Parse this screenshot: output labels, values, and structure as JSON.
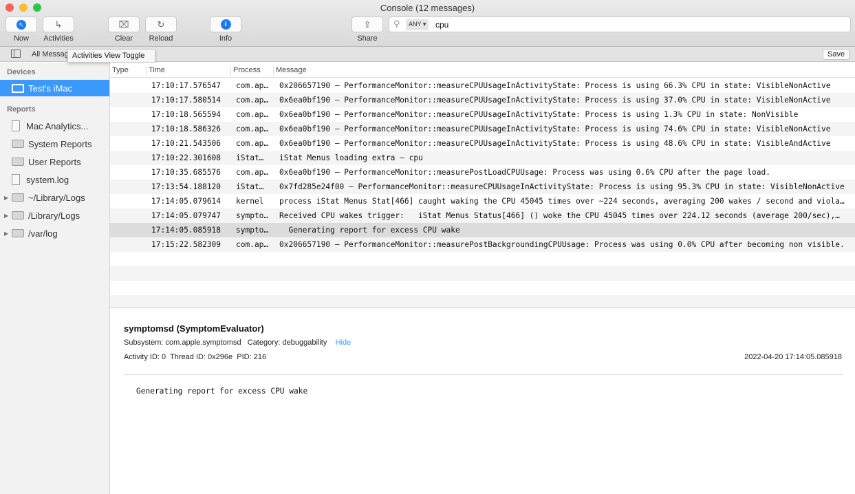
{
  "window": {
    "title": "Console (12 messages)"
  },
  "toolbar": {
    "now": "Now",
    "activities": "Activities",
    "clear": "Clear",
    "reload": "Reload",
    "info": "Info",
    "share": "Share"
  },
  "search": {
    "scope": "ANY",
    "query": "cpu"
  },
  "filterbar": {
    "label": "All Messages",
    "save": "Save"
  },
  "tooltip": "Activities View Toggle",
  "sidebar": {
    "devices_header": "Devices",
    "device": "Test’s iMac",
    "reports_header": "Reports",
    "items": [
      {
        "label": "Mac Analytics...",
        "icon": "doc"
      },
      {
        "label": "System Reports",
        "icon": "folder"
      },
      {
        "label": "User Reports",
        "icon": "folder"
      },
      {
        "label": "system.log",
        "icon": "doc"
      },
      {
        "label": "~/Library/Logs",
        "icon": "folder",
        "expandable": true
      },
      {
        "label": "/Library/Logs",
        "icon": "folder",
        "expandable": true
      },
      {
        "label": "/var/log",
        "icon": "folder",
        "expandable": true
      }
    ]
  },
  "table": {
    "columns": [
      "Type",
      "Time",
      "Process",
      "Message"
    ],
    "rows": [
      {
        "time": "17:10:17.576547",
        "process": "com.ap…",
        "message": "0x206657190 – PerformanceMonitor::measureCPUUsageInActivityState: Process is using 66.3% CPU in state: VisibleNonActive"
      },
      {
        "time": "17:10:17.580514",
        "process": "com.ap…",
        "message": "0x6ea0bf190 – PerformanceMonitor::measureCPUUsageInActivityState: Process is using 37.0% CPU in state: VisibleNonActive"
      },
      {
        "time": "17:10:18.565594",
        "process": "com.ap…",
        "message": "0x6ea0bf190 – PerformanceMonitor::measureCPUUsageInActivityState: Process is using 1.3% CPU in state: NonVisible"
      },
      {
        "time": "17:10:18.586326",
        "process": "com.ap…",
        "message": "0x6ea0bf190 – PerformanceMonitor::measureCPUUsageInActivityState: Process is using 74.6% CPU in state: VisibleNonActive"
      },
      {
        "time": "17:10:21.543506",
        "process": "com.ap…",
        "message": "0x6ea0bf190 – PerformanceMonitor::measureCPUUsageInActivityState: Process is using 48.6% CPU in state: VisibleAndActive"
      },
      {
        "time": "17:10:22.301608",
        "process": "iStat…",
        "message": "iStat Menus loading extra – cpu"
      },
      {
        "time": "17:10:35.685576",
        "process": "com.ap…",
        "message": "0x6ea0bf190 – PerformanceMonitor::measurePostLoadCPUUsage: Process was using 0.6% CPU after the page load."
      },
      {
        "time": "17:13:54.188120",
        "process": "iStat…",
        "message": "0x7fd285e24f00 – PerformanceMonitor::measureCPUUsageInActivityState: Process is using 95.3% CPU in state: VisibleNonActive"
      },
      {
        "time": "17:14:05.079614",
        "process": "kernel",
        "message": "process iStat Menus Stat[466] caught waking the CPU 45045 times over ~224 seconds, averaging 200 wakes / second and viola…"
      },
      {
        "time": "17:14:05.079747",
        "process": "sympto…",
        "message": "Received CPU wakes trigger:   iStat Menus Status[466] () woke the CPU 45045 times over 224.12 seconds (average 200/sec),…"
      },
      {
        "time": "17:14:05.085918",
        "process": "sympto…",
        "message": "  Generating report for excess CPU wake",
        "selected": true
      },
      {
        "time": "17:15:22.582309",
        "process": "com.ap…",
        "message": "0x206657190 – PerformanceMonitor::measurePostBackgroundingCPUUsage: Process was using 0.0% CPU after becoming non visible."
      }
    ]
  },
  "detail": {
    "title": "symptomsd (SymptomEvaluator)",
    "subsystem": "Subsystem: com.apple.symptomsd",
    "category": "Category: debuggability",
    "hide": "Hide",
    "ids": "Activity ID: 0  Thread ID: 0x296e  PID: 216",
    "timestamp": "2022-04-20 17:14:05.085918",
    "message": "Generating report for excess CPU wake"
  }
}
